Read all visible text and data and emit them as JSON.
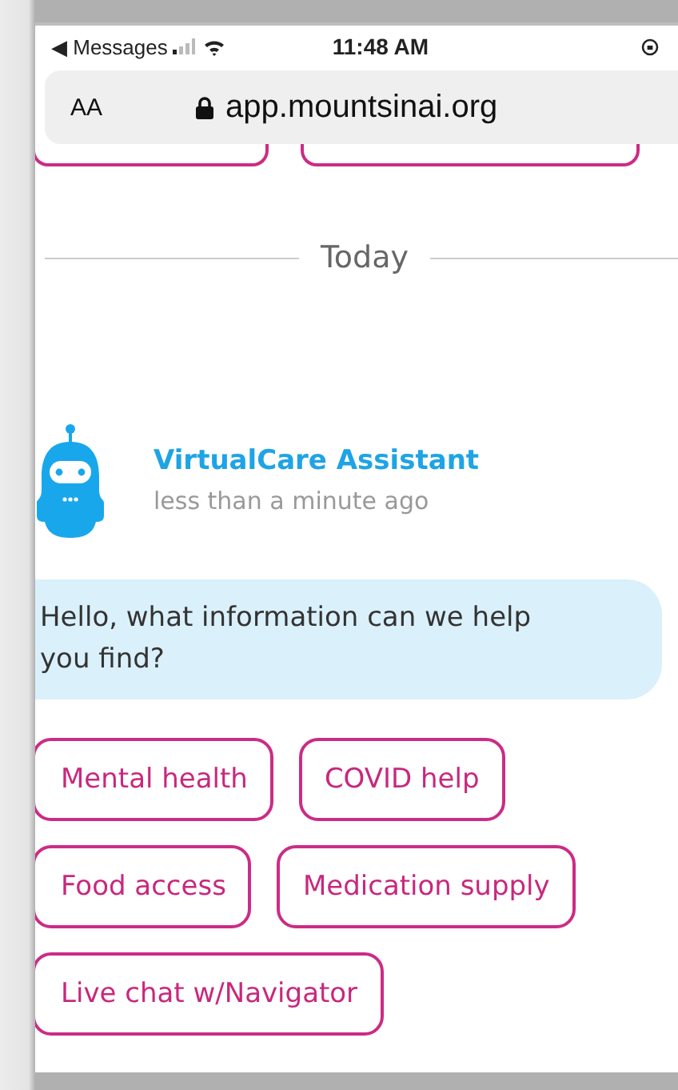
{
  "status_bar": {
    "back_label": "◀ Messages",
    "time": "11:48 AM"
  },
  "address_bar": {
    "text_size": "AA",
    "url": "app.mountsinai.org"
  },
  "divider": {
    "label": "Today"
  },
  "message": {
    "sender": "VirtualCare Assistant",
    "time": "less than a minute ago",
    "text": "Hello, what information can we help you find?"
  },
  "option_rows": [
    [
      "Mental health",
      "COVID help"
    ],
    [
      "Food access",
      "Medication supply"
    ],
    [
      "Live chat w/Navigator"
    ]
  ]
}
